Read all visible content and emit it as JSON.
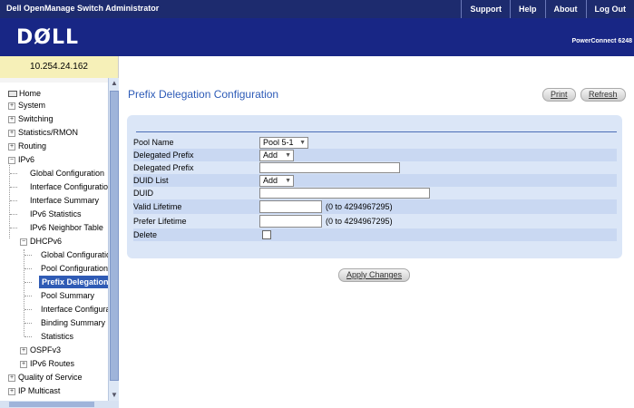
{
  "topbar": {
    "title": "Dell OpenManage Switch Administrator",
    "menu": [
      "Support",
      "Help",
      "About",
      "Log Out"
    ]
  },
  "brand": {
    "logo": "DØLL",
    "product": "PowerConnect 6248"
  },
  "ip_address": "10.254.24.162",
  "tree": [
    {
      "label": "Home",
      "icon": "home-icon"
    },
    {
      "label": "System",
      "expander": "+"
    },
    {
      "label": "Switching",
      "expander": "+"
    },
    {
      "label": "Statistics/RMON",
      "expander": "+"
    },
    {
      "label": "Routing",
      "expander": "+"
    },
    {
      "label": "IPv6",
      "expander": "−"
    },
    {
      "label": "Global Configuration"
    },
    {
      "label": "Interface Configuratio"
    },
    {
      "label": "Interface Summary"
    },
    {
      "label": "IPv6 Statistics"
    },
    {
      "label": "IPv6 Neighbor Table"
    },
    {
      "label": "DHCPv6",
      "expander": "−"
    },
    {
      "label": "Global Configuratic"
    },
    {
      "label": "Pool Configuration"
    },
    {
      "label": "Prefix Delegation",
      "selected": true
    },
    {
      "label": "Pool Summary"
    },
    {
      "label": "Interface Configura"
    },
    {
      "label": "Binding Summary"
    },
    {
      "label": "Statistics"
    },
    {
      "label": "OSPFv3",
      "expander": "+"
    },
    {
      "label": "IPv6 Routes",
      "expander": "+"
    },
    {
      "label": "Quality of Service",
      "expander": "+"
    },
    {
      "label": "IP Multicast",
      "expander": "+"
    }
  ],
  "page": {
    "title": "Prefix Delegation Configuration",
    "print_label": "Print",
    "refresh_label": "Refresh",
    "apply_label": "Apply Changes"
  },
  "form": {
    "pool_name": {
      "label": "Pool Name",
      "value": "Pool 5-1"
    },
    "delegated_prefix_action": {
      "label": "Delegated Prefix",
      "value": "Add"
    },
    "delegated_prefix": {
      "label": "Delegated Prefix",
      "value": ""
    },
    "duid_list": {
      "label": "DUID List",
      "value": "Add"
    },
    "duid": {
      "label": "DUID",
      "value": ""
    },
    "valid_lifetime": {
      "label": "Valid Lifetime",
      "value": "",
      "hint": "(0 to 4294967295)"
    },
    "prefer_lifetime": {
      "label": "Prefer Lifetime",
      "value": "",
      "hint": "(0 to 4294967295)"
    },
    "delete": {
      "label": "Delete",
      "checked": false
    }
  }
}
